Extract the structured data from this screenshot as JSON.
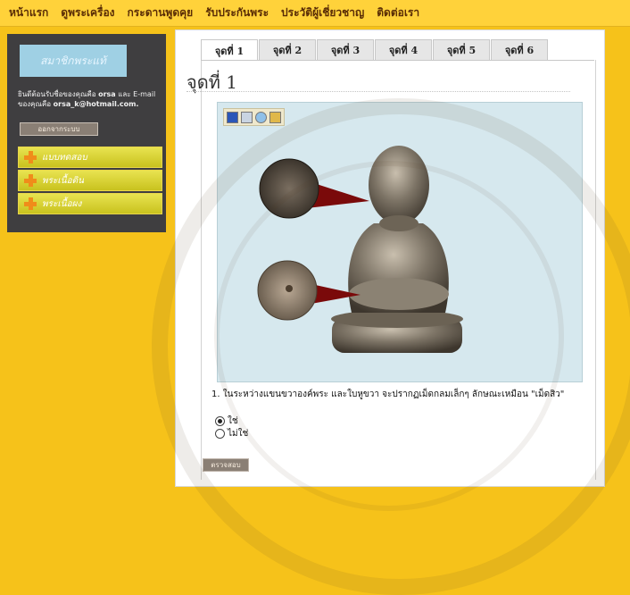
{
  "top_nav": [
    "หน้าแรก",
    "ดูพระเครื่อง",
    "กระดานพูดคุย",
    "รับประกันพระ",
    "ประวัติผู้เชี่ยวชาญ",
    "ติดต่อเรา"
  ],
  "sidebar": {
    "logo_text": "สมาชิกพระแท้",
    "welcome_text": "ยินดีต้อนรับชื่อของคุณคือ",
    "user_name": "orsa",
    "welcome_mid": "และ E-mail ของคุณคือ",
    "email": "orsa_k@hotmail.com.",
    "logout_label": "ออกจากระบบ",
    "menu": [
      "แบบทดสอบ",
      "พระเนื้อดิน",
      "พระเนื้อผง"
    ]
  },
  "tabs": [
    "จุดที่ 1",
    "จุดที่ 2",
    "จุดที่ 3",
    "จุดที่ 4",
    "จุดที่ 5",
    "จุดที่ 6"
  ],
  "active_tab": 0,
  "point_title": "จุดที่ 1",
  "toolbar_icons": [
    "save-icon",
    "print-icon",
    "refresh-icon",
    "email-icon"
  ],
  "question": "1. ในระหว่างแขนขวาองค์พระ และใบหูขวา จะปรากฏเม็ดกลมเล็กๆ ลักษณะเหมือน \"เม็ดสิว\"",
  "options": [
    {
      "label": "ใช่",
      "selected": true
    },
    {
      "label": "ไม่ใช่",
      "selected": false
    }
  ],
  "check_button": "ตรวจสอบ",
  "colors": {
    "background": "#f6c21a",
    "nav_bg": "#ffd23a",
    "sidebar_bg": "#3f3e40",
    "image_bg": "#d6e8ee",
    "callout": "#7a0a0a"
  }
}
